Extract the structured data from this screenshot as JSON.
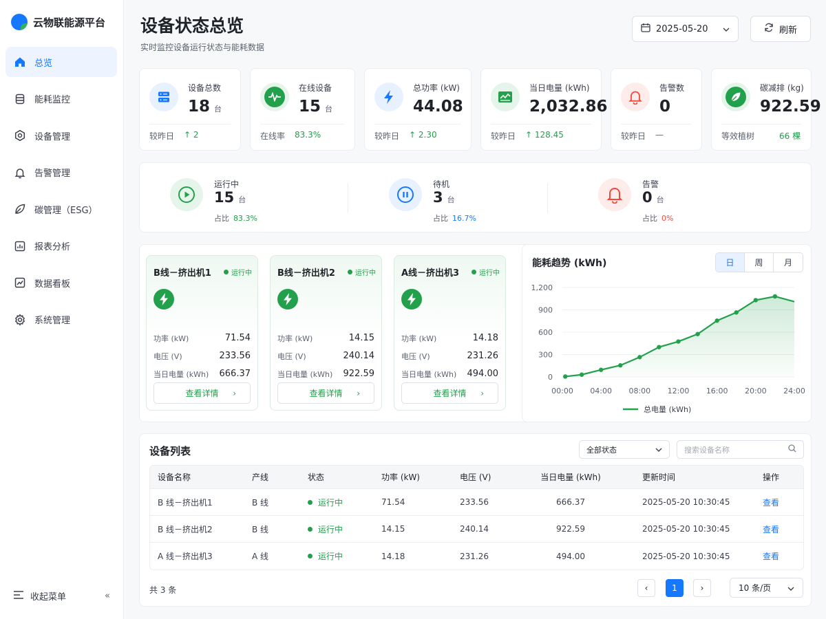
{
  "app": {
    "title": "云物联能源平台"
  },
  "sidebar": {
    "items": [
      {
        "label": "总览",
        "icon": "home-icon"
      },
      {
        "label": "能耗监控",
        "icon": "database-icon"
      },
      {
        "label": "设备管理",
        "icon": "device-gear-icon"
      },
      {
        "label": "告警管理",
        "icon": "bell-icon"
      },
      {
        "label": "碳管理（ESG）",
        "icon": "leaf-icon"
      },
      {
        "label": "报表分析",
        "icon": "report-icon"
      },
      {
        "label": "数据看板",
        "icon": "dashboard-icon"
      },
      {
        "label": "系统管理",
        "icon": "settings-icon"
      }
    ],
    "collapse_label": "收起菜单"
  },
  "header": {
    "title": "设备状态总览",
    "subtitle": "实时监控设备运行状态与能耗数据",
    "date": "2025-05-20",
    "refresh_label": "刷新"
  },
  "stats": [
    {
      "label": "设备总数",
      "value": "18",
      "unit": "台",
      "foot_label": "较昨日",
      "foot_value": "↑ 2",
      "icon": "server-icon"
    },
    {
      "label": "在线设备",
      "value": "15",
      "unit": "台",
      "foot_label": "在线率",
      "foot_value": "83.3%",
      "icon": "pulse-icon"
    },
    {
      "label": "总功率 (kW)",
      "value": "44.08",
      "unit": "",
      "foot_label": "较昨日",
      "foot_value": "↑ 2.30",
      "icon": "bolt-icon"
    },
    {
      "label": "当日电量 (kWh)",
      "value": "2,032.86",
      "unit": "",
      "foot_label": "较昨日",
      "foot_value": "↑ 128.45",
      "icon": "chart-icon"
    },
    {
      "label": "告警数",
      "value": "0",
      "unit": "",
      "foot_label": "较昨日",
      "foot_value": "—",
      "icon": "bell-icon"
    },
    {
      "label": "碳减排 (kg)",
      "value": "922.59",
      "unit": "",
      "foot_label": "等效植树",
      "foot_value": "66 棵",
      "icon": "leaf-icon"
    }
  ],
  "status_summary": [
    {
      "label": "运行中",
      "value": "15",
      "unit": "台",
      "ratio_label": "占比",
      "ratio": "83.3%"
    },
    {
      "label": "待机",
      "value": "3",
      "unit": "台",
      "ratio_label": "占比",
      "ratio": "16.7%"
    },
    {
      "label": "告警",
      "value": "0",
      "unit": "台",
      "ratio_label": "占比",
      "ratio": "0%"
    }
  ],
  "machines": [
    {
      "name": "B线－挤出机1",
      "status": "运行中",
      "power_label": "功率 (kW)",
      "power": "71.54",
      "voltage_label": "电压 (V)",
      "voltage": "233.56",
      "energy_label": "当日电量 (kWh)",
      "energy": "666.37",
      "button": "查看详情"
    },
    {
      "name": "B线－挤出机2",
      "status": "运行中",
      "power_label": "功率 (kW)",
      "power": "14.15",
      "voltage_label": "电压 (V)",
      "voltage": "240.14",
      "energy_label": "当日电量 (kWh)",
      "energy": "922.59",
      "button": "查看详情"
    },
    {
      "name": "A线－挤出机3",
      "status": "运行中",
      "power_label": "功率 (kW)",
      "power": "14.18",
      "voltage_label": "电压 (V)",
      "voltage": "231.26",
      "energy_label": "当日电量 (kWh)",
      "energy": "494.00",
      "button": "查看详情"
    }
  ],
  "chart_panel": {
    "title": "能耗趋势 (kWh)",
    "tabs": [
      "日",
      "周",
      "月"
    ],
    "active_tab": "日"
  },
  "chart_data": {
    "type": "area",
    "title": "能耗趋势 (kWh)",
    "x_ticks": [
      "00:00",
      "04:00",
      "08:00",
      "12:00",
      "16:00",
      "20:00",
      "24:00"
    ],
    "y_ticks": [
      "0",
      "300",
      "600",
      "900",
      "1,200"
    ],
    "ylim": [
      0,
      1200
    ],
    "xlim_hours": [
      0,
      24
    ],
    "grid": true,
    "legend_position": "bottom",
    "series": [
      {
        "name": "总电量 (kWh)",
        "color": "#22a04b",
        "x_hours": [
          0.3,
          2,
          4,
          6,
          8,
          10,
          12,
          14,
          16,
          18,
          20,
          22,
          24
        ],
        "values": [
          5,
          30,
          95,
          155,
          265,
          400,
          475,
          575,
          755,
          865,
          1030,
          1080,
          1010
        ]
      }
    ]
  },
  "device_list": {
    "title": "设备列表",
    "filter": "全部状态",
    "search_placeholder": "搜索设备名称",
    "columns": [
      "设备名称",
      "产线",
      "状态",
      "功率 (kW)",
      "电压 (V)",
      "当日电量 (kWh)",
      "更新时间",
      "操作"
    ],
    "rows": [
      [
        "B 线－挤出机1",
        "B 线",
        "运行中",
        "71.54",
        "233.56",
        "666.37",
        "2025-05-20 10:30:45",
        "查看"
      ],
      [
        "B 线－挤出机2",
        "B 线",
        "运行中",
        "14.15",
        "240.14",
        "922.59",
        "2025-05-20 10:30:45",
        "查看"
      ],
      [
        "A 线－挤出机3",
        "A 线",
        "运行中",
        "14.18",
        "231.26",
        "494.00",
        "2025-05-20 10:30:45",
        "查看"
      ]
    ],
    "total": "共 3 条",
    "page": "1",
    "page_size": "10 条/页"
  },
  "colors": {
    "primary": "#1677ff",
    "success": "#22a04b",
    "danger": "#f5483b"
  }
}
